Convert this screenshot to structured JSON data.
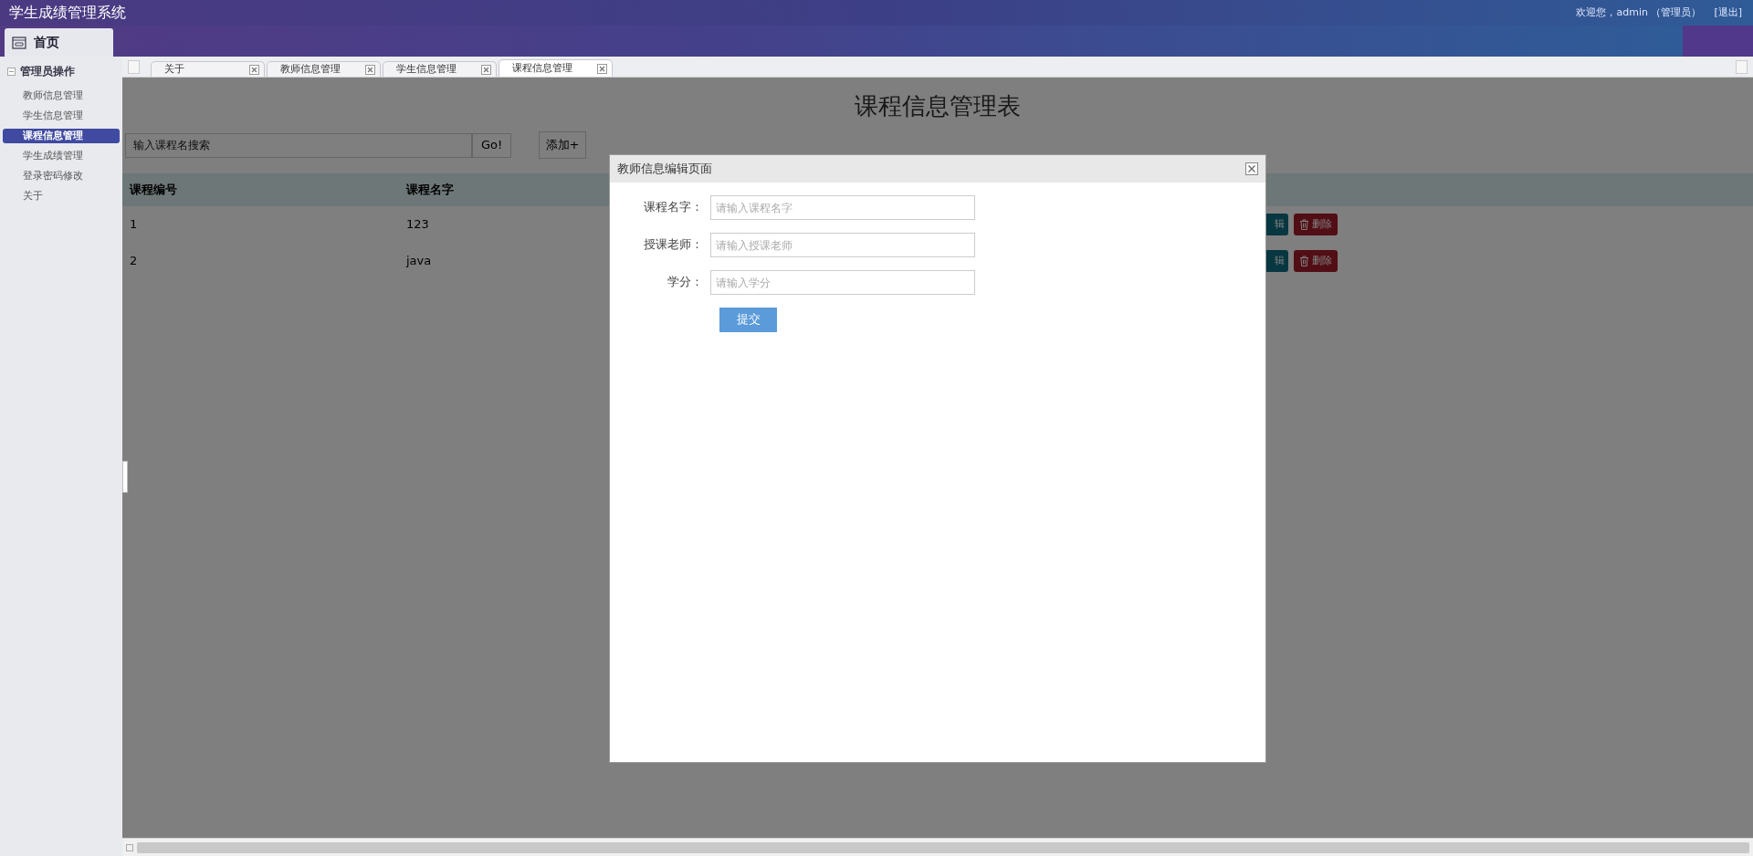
{
  "app": {
    "title": "学生成绩管理系统",
    "user_greeting": "欢迎您，admin （管理员）",
    "logout": "[退出]"
  },
  "main_tabs": [
    {
      "label": "首页",
      "selected": true
    }
  ],
  "sidebar": {
    "group": {
      "label": "管理员操作",
      "expanded": true
    },
    "items": [
      {
        "label": "教师信息管理",
        "selected": false
      },
      {
        "label": "学生信息管理",
        "selected": false
      },
      {
        "label": "课程信息管理",
        "selected": true
      },
      {
        "label": "学生成绩管理",
        "selected": false
      },
      {
        "label": "登录密码修改",
        "selected": false
      },
      {
        "label": "关于",
        "selected": false
      }
    ]
  },
  "page_tabs": [
    {
      "label": "关于",
      "selected": false
    },
    {
      "label": "教师信息管理",
      "selected": false
    },
    {
      "label": "学生信息管理",
      "selected": false
    },
    {
      "label": "课程信息管理",
      "selected": true
    }
  ],
  "page": {
    "title": "课程信息管理表",
    "search": {
      "placeholder": "输入课程名搜索"
    },
    "search_button": "Go!",
    "add_button": "添加+",
    "table": {
      "columns": [
        "课程编号",
        "课程名字"
      ],
      "rows": [
        {
          "cells": [
            "1",
            "123"
          ],
          "actions": [
            {
              "kind": "edit",
              "label": "辑"
            },
            {
              "kind": "delete",
              "label": "删除"
            }
          ]
        },
        {
          "cells": [
            "2",
            "java"
          ],
          "actions": [
            {
              "kind": "edit",
              "label": "辑"
            },
            {
              "kind": "delete",
              "label": "删除"
            }
          ]
        }
      ]
    }
  },
  "dialog": {
    "title": "教师信息编辑页面",
    "fields": [
      {
        "label": "课程名字：",
        "placeholder": "请输入课程名字"
      },
      {
        "label": "授课老师：",
        "placeholder": "请输入授课老师"
      },
      {
        "label": "学分：",
        "placeholder": "请输入学分"
      }
    ],
    "submit": "提交"
  }
}
